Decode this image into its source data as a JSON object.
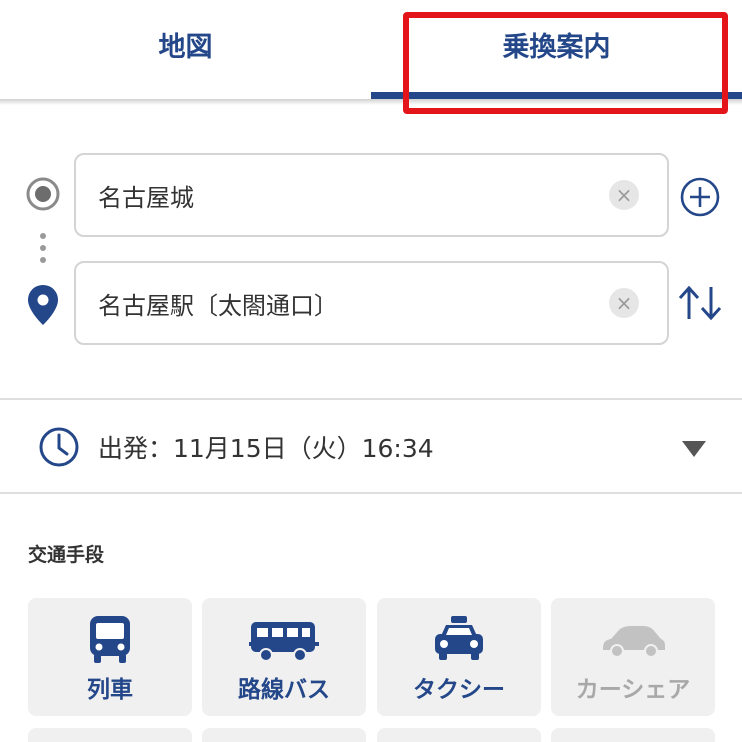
{
  "tabs": {
    "map_label": "地図",
    "transit_label": "乗換案内"
  },
  "route": {
    "origin": "名古屋城",
    "destination": "名古屋駅〔太閤通口〕",
    "clear_symbol": "×"
  },
  "departure": {
    "text": "出発：11月15日（火）16:34"
  },
  "transport": {
    "title": "交通手段",
    "modes": [
      {
        "label": "列車",
        "icon": "train-icon",
        "enabled": true
      },
      {
        "label": "路線バス",
        "icon": "bus-icon",
        "enabled": true
      },
      {
        "label": "タクシー",
        "icon": "taxi-icon",
        "enabled": true
      },
      {
        "label": "カーシェア",
        "icon": "car-icon",
        "enabled": false
      }
    ]
  },
  "colors": {
    "accent": "#24478a",
    "highlight": "#e3151a",
    "disabled": "#a8a8a8"
  }
}
